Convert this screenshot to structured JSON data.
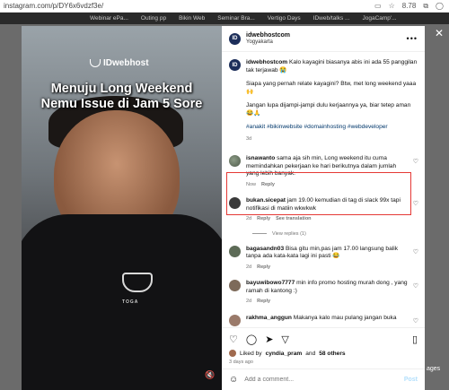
{
  "browser": {
    "url": "instagram.com/p/DY6x6vdzf3e/",
    "bookmarks": [
      "Webinar ePa...",
      "Outing pp",
      "Bikin Web",
      "Seminar Bra...",
      "Vertigo Days",
      "IDweb/talks ...",
      "JogaCamp'..."
    ],
    "badge": "8.78"
  },
  "post": {
    "image": {
      "brand": "IDwebhost",
      "headline_line1": "Menuju Long Weekend",
      "headline_line2": "Nemu Issue di Jam 5 Sore",
      "shirt_text": "TOGA"
    },
    "header": {
      "username": "idwebhostcom",
      "location": "Yogyakarta"
    },
    "caption": {
      "username": "idwebhostcom",
      "line1": "Kalo kayagini biasanya abis ini ada 55 panggilan tak terjawab 😭",
      "line2": "Siapa yang pernah relate kayagini? Btw, met long weekend yaaa 🙌",
      "line3": "Jangan lupa dijampi-jampi dulu kerjaannya ya, biar tetep aman 😂🙏",
      "hashtags": "#anakit #bikinwebsite #domainhosting #webdeveloper",
      "time": "3d"
    },
    "comments": [
      {
        "username": "isnawanto",
        "text": "sama aja sih min, Long weekend itu cuma memindahkan pekerjaan ke hari berikutnya dalam jumlah yang lebih banyak.",
        "time": "Now",
        "reply": "Reply"
      },
      {
        "username": "bukan.sicepat",
        "text": "jam 19.00 kemudian di tag di slack 99x tapi notifikasi di matiin wkwkwk",
        "time": "2d",
        "reply": "Reply",
        "translate": "See translation",
        "view_replies": "View replies (1)"
      },
      {
        "username": "bagasandn03",
        "text": "Bisa gitu min,pas jam 17.00 langsung balik tanpa ada kata-kata lagi ini pasti 😂",
        "time": "2d",
        "reply": "Reply"
      },
      {
        "username": "bayuwibowo7777",
        "text": "min info promo hosting murah dong , yang ramah di kantong :)",
        "time": "2d",
        "reply": "Reply"
      },
      {
        "username": "rakhma_anggun",
        "text": "Makanya kalo mau pulang jangan buka",
        "time": "",
        "reply": ""
      }
    ],
    "likes": {
      "prefix": "Liked by",
      "user": "cyndia_pram",
      "connector": "and",
      "others": "58 others"
    },
    "date": "3 days ago",
    "add_comment": {
      "placeholder": "Add a comment...",
      "post_label": "Post"
    }
  },
  "page_side_text": "ages"
}
